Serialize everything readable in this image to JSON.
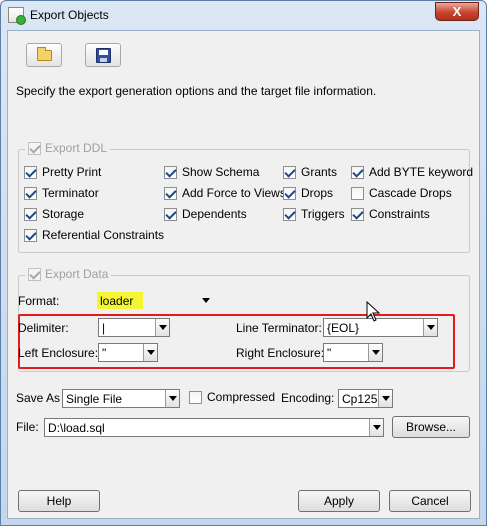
{
  "window": {
    "title": "Export Objects",
    "close_label": "X"
  },
  "toolbar": {
    "open_icon": "folder-open-icon",
    "save_icon": "floppy-save-icon"
  },
  "description": "Specify the export generation options and the target file information.",
  "ddl": {
    "title": "Export DDL",
    "checked": true,
    "options": [
      {
        "label": "Pretty Print",
        "checked": true
      },
      {
        "label": "Show Schema",
        "checked": true
      },
      {
        "label": "Grants",
        "checked": true
      },
      {
        "label": "Add BYTE keyword",
        "checked": true
      },
      {
        "label": "Terminator",
        "checked": true
      },
      {
        "label": "Add Force to Views",
        "checked": true
      },
      {
        "label": "Drops",
        "checked": true
      },
      {
        "label": "Cascade Drops",
        "checked": false
      },
      {
        "label": "Storage",
        "checked": true
      },
      {
        "label": "Dependents",
        "checked": true
      },
      {
        "label": "Triggers",
        "checked": true
      },
      {
        "label": "Constraints",
        "checked": true
      },
      {
        "label": "Referential Constraints",
        "checked": true
      }
    ]
  },
  "data": {
    "title": "Export Data",
    "checked": true,
    "format_label": "Format:",
    "format_value": "loader",
    "highlight_color": "#f5f533",
    "delimiter_label": "Delimiter:",
    "delimiter_value": "|",
    "line_terminator_label": "Line Terminator:",
    "line_terminator_value": "{EOL}",
    "left_enclosure_label": "Left Enclosure:",
    "left_enclosure_value": "\"",
    "right_enclosure_label": "Right Enclosure:",
    "right_enclosure_value": "\"",
    "box_color": "#e21b1b"
  },
  "output": {
    "save_as_label": "Save As",
    "save_as_value": "Single File",
    "compressed_label": "Compressed",
    "compressed_checked": false,
    "encoding_label": "Encoding:",
    "encoding_value": "Cp1252",
    "file_label": "File:",
    "file_value": "D:\\load.sql",
    "browse_label": "Browse..."
  },
  "buttons": {
    "help": "Help",
    "apply": "Apply",
    "cancel": "Cancel"
  }
}
